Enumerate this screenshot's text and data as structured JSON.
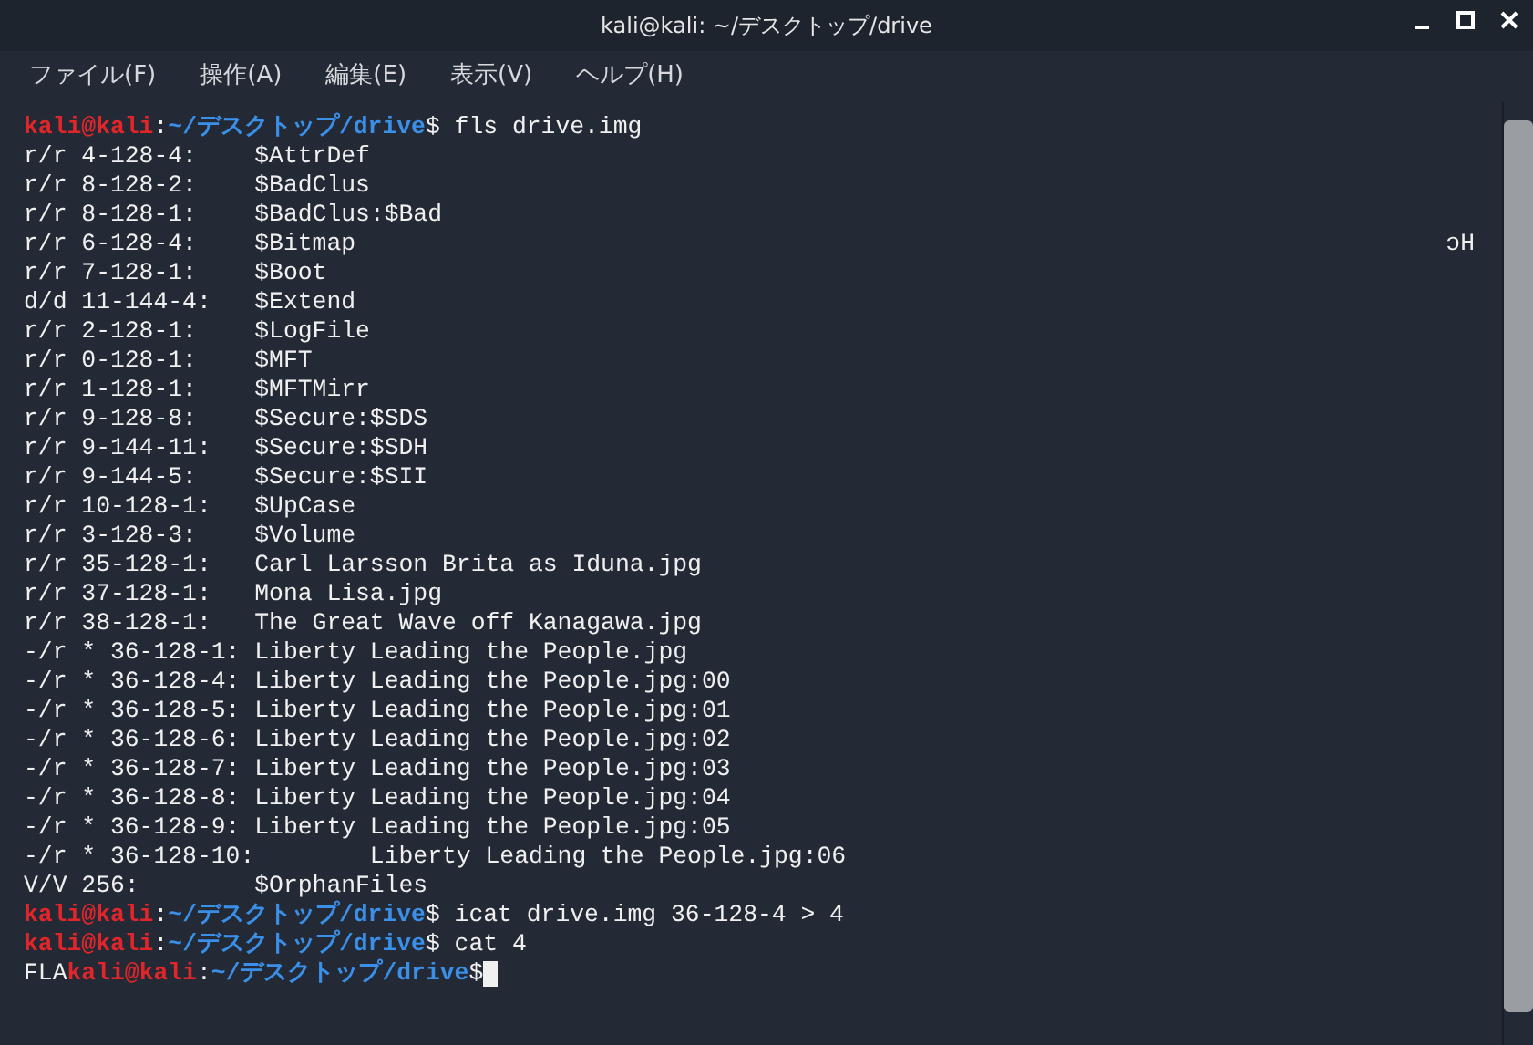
{
  "window": {
    "title": "kali@kali: ~/デスクトップ/drive"
  },
  "menu": [
    "ファイル(F)",
    "操作(A)",
    "編集(E)",
    "表示(V)",
    "ヘルプ(H)"
  ],
  "terminal": {
    "lines": [
      {
        "kind": "prompt",
        "user": "kali@kali",
        "separator": ":",
        "path": "~/デスクトップ/drive",
        "command": "$ fls drive.img"
      },
      {
        "kind": "output",
        "text": "r/r 4-128-4:    $AttrDef"
      },
      {
        "kind": "output",
        "text": "r/r 8-128-2:    $BadClus"
      },
      {
        "kind": "output",
        "text": "r/r 8-128-1:    $BadClus:$Bad"
      },
      {
        "kind": "output",
        "text": "r/r 6-128-4:    $Bitmap",
        "tail": "ɔH"
      },
      {
        "kind": "output",
        "text": "r/r 7-128-1:    $Boot"
      },
      {
        "kind": "output",
        "text": "d/d 11-144-4:   $Extend"
      },
      {
        "kind": "output",
        "text": "r/r 2-128-1:    $LogFile"
      },
      {
        "kind": "output",
        "text": "r/r 0-128-1:    $MFT"
      },
      {
        "kind": "output",
        "text": "r/r 1-128-1:    $MFTMirr"
      },
      {
        "kind": "output",
        "text": "r/r 9-128-8:    $Secure:$SDS"
      },
      {
        "kind": "output",
        "text": "r/r 9-144-11:   $Secure:$SDH"
      },
      {
        "kind": "output",
        "text": "r/r 9-144-5:    $Secure:$SII"
      },
      {
        "kind": "output",
        "text": "r/r 10-128-1:   $UpCase"
      },
      {
        "kind": "output",
        "text": "r/r 3-128-3:    $Volume"
      },
      {
        "kind": "output",
        "text": "r/r 35-128-1:   Carl Larsson Brita as Iduna.jpg"
      },
      {
        "kind": "output",
        "text": "r/r 37-128-1:   Mona Lisa.jpg"
      },
      {
        "kind": "output",
        "text": "r/r 38-128-1:   The Great Wave off Kanagawa.jpg"
      },
      {
        "kind": "output",
        "text": "-/r * 36-128-1: Liberty Leading the People.jpg"
      },
      {
        "kind": "output",
        "text": "-/r * 36-128-4: Liberty Leading the People.jpg:00"
      },
      {
        "kind": "output",
        "text": "-/r * 36-128-5: Liberty Leading the People.jpg:01"
      },
      {
        "kind": "output",
        "text": "-/r * 36-128-6: Liberty Leading the People.jpg:02"
      },
      {
        "kind": "output",
        "text": "-/r * 36-128-7: Liberty Leading the People.jpg:03"
      },
      {
        "kind": "output",
        "text": "-/r * 36-128-8: Liberty Leading the People.jpg:04"
      },
      {
        "kind": "output",
        "text": "-/r * 36-128-9: Liberty Leading the People.jpg:05"
      },
      {
        "kind": "output",
        "text": "-/r * 36-128-10:        Liberty Leading the People.jpg:06"
      },
      {
        "kind": "output",
        "text": "V/V 256:        $OrphanFiles"
      },
      {
        "kind": "prompt",
        "user": "kali@kali",
        "separator": ":",
        "path": "~/デスクトップ/drive",
        "command": "$ icat drive.img 36-128-4 > 4"
      },
      {
        "kind": "prompt",
        "user": "kali@kali",
        "separator": ":",
        "path": "~/デスクトップ/drive",
        "command": "$ cat 4"
      },
      {
        "kind": "prompt",
        "prefix": "FLA",
        "user": "kali@kali",
        "separator": ":",
        "path": "~/デスクトップ/drive",
        "command": "$",
        "cursor": true
      }
    ]
  }
}
